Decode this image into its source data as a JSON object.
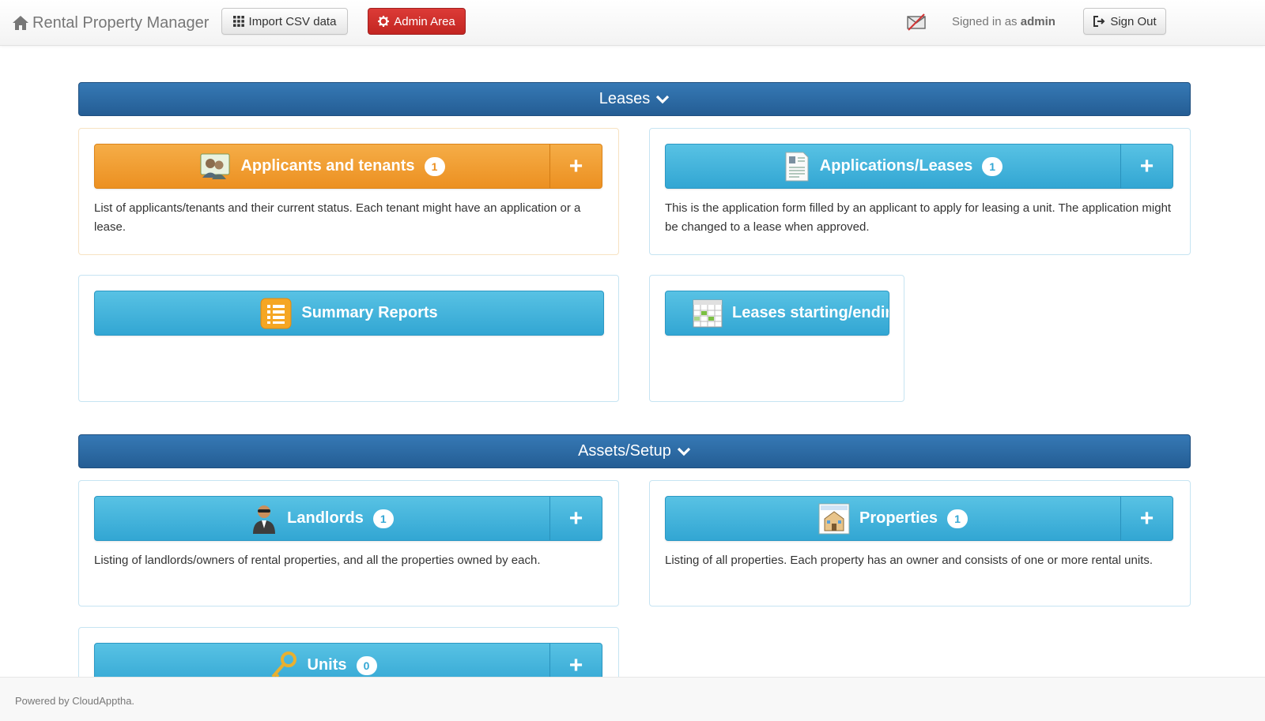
{
  "navbar": {
    "brand": "Rental Property Manager",
    "import_label": "Import CSV data",
    "admin_label": "Admin Area",
    "signed_in_prefix": "Signed in as",
    "username": "admin",
    "signout_label": "Sign Out"
  },
  "sections": {
    "leases": "Leases",
    "assets": "Assets/Setup"
  },
  "tiles": {
    "applicants": {
      "title": "Applicants and tenants",
      "count": "1",
      "add": "+",
      "description": "List of applicants/tenants and their current status. Each tenant might have an application or a lease."
    },
    "applications": {
      "title": "Applications/Leases",
      "count": "1",
      "add": "+",
      "description": "This is the application form filled by an applicant to apply for leasing a unit. The application might be changed to a lease when approved."
    },
    "summary": {
      "title": "Summary Reports"
    },
    "leases_dates": {
      "title": "Leases starting/endin"
    },
    "landlords": {
      "title": "Landlords",
      "count": "1",
      "add": "+",
      "description": "Listing of landlords/owners of rental properties, and all the properties owned by each."
    },
    "properties": {
      "title": "Properties",
      "count": "1",
      "add": "+",
      "description": "Listing of all properties. Each property has an owner and consists of one or more rental units."
    },
    "units": {
      "title": "Units",
      "count": "0",
      "add": "+"
    }
  },
  "footer": {
    "text": "Powered by CloudAppt­ha."
  },
  "colors": {
    "section_blue": "#2b6aa6",
    "tile_info": "#40b2dc",
    "tile_warning": "#f09a2c",
    "danger": "#d22f2b"
  }
}
